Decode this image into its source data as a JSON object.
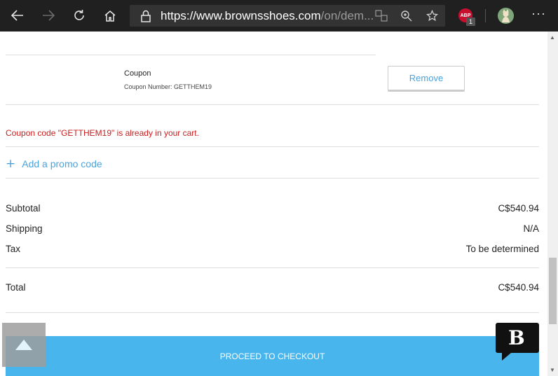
{
  "browser": {
    "url_main": "https://www.brownsshoes.com",
    "url_rest": "/on/dem...",
    "abp_label": "ABP",
    "abp_count": "1",
    "more_label": "···"
  },
  "coupon": {
    "title": "Coupon",
    "number_text": "Coupon Number: GETTHEM19",
    "remove_label": "Remove"
  },
  "error_message": "Coupon code \"GETTHEM19\" is already in your cart.",
  "promo": {
    "plus": "+",
    "label": "Add a promo code"
  },
  "summary": {
    "subtotal_label": "Subtotal",
    "subtotal_value": "C$540.94",
    "shipping_label": "Shipping",
    "shipping_value": "N/A",
    "tax_label": "Tax",
    "tax_value": "To be determined",
    "total_label": "Total",
    "total_value": "C$540.94"
  },
  "checkout_label": "PROCEED TO CHECKOUT",
  "chat_logo_letter": "B",
  "colors": {
    "accent": "#48b5ec",
    "link": "#4aa3df",
    "error": "#c81e1e",
    "toolbar": "#202020"
  }
}
